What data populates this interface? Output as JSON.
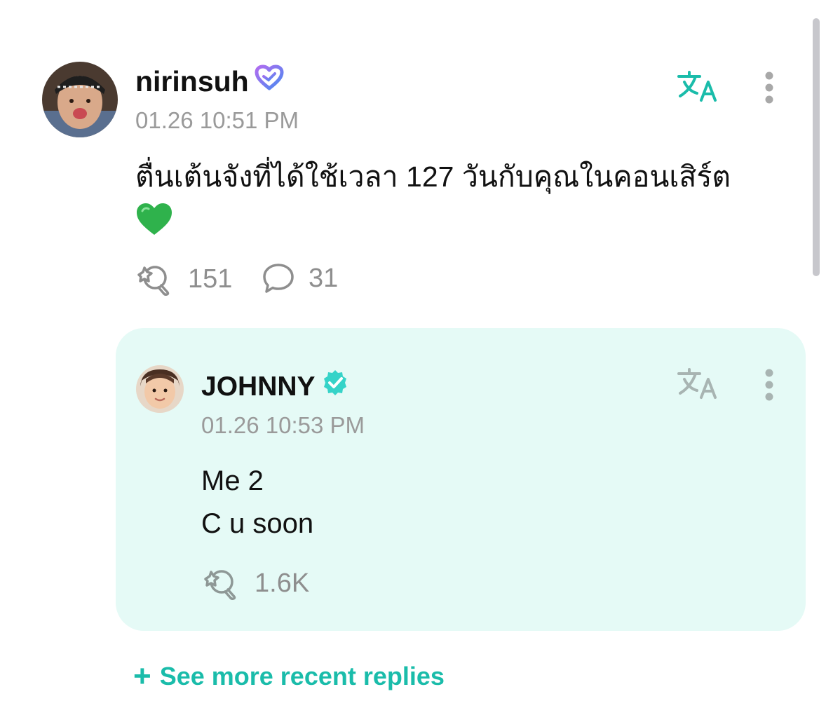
{
  "post": {
    "username": "nirinsuh",
    "badge_icon": "fan-heart-icon",
    "timestamp": "01.26 10:51 PM",
    "body_line_1": "ตื่นเต้นจังที่ได้ใช้เวลา 127 วันกับคุณในคอนเสิร์ต",
    "body_emoji": "💚",
    "reaction_count": "151",
    "comment_count": "31"
  },
  "reply": {
    "username": "JOHNNY",
    "badge_icon": "verified-badge-icon",
    "timestamp": "01.26 10:53 PM",
    "body_line_1": "Me 2",
    "body_line_2": "C u soon",
    "reaction_count": "1.6K"
  },
  "see_more": {
    "plus": "+",
    "label": "See more recent replies"
  },
  "colors": {
    "accent": "#1abcaa",
    "reply_background": "#e5faf6",
    "muted_text": "#9a9a9a",
    "primary_text": "#111111"
  }
}
